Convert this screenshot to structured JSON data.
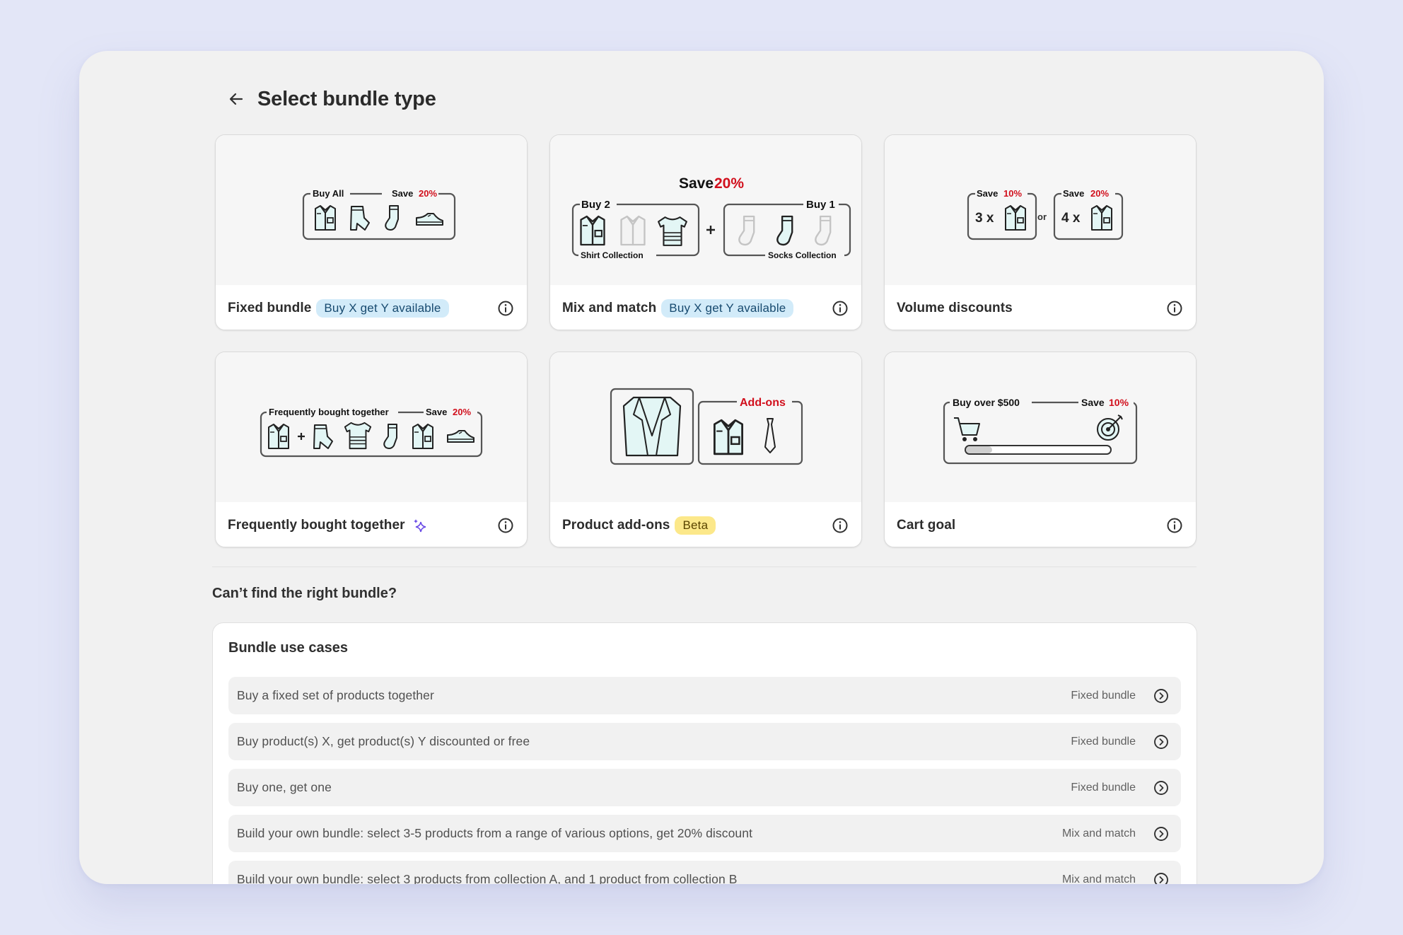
{
  "page": {
    "title": "Select bundle type"
  },
  "cards": [
    {
      "title": "Fixed bundle",
      "badge": "Buy X get Y available",
      "illus": {
        "left_label": "Buy All",
        "right_label": "Save",
        "percent": "20%"
      }
    },
    {
      "title": "Mix and match",
      "badge": "Buy X get Y available",
      "illus": {
        "heading": "Save",
        "percent": "20%",
        "left_top": "Buy 2",
        "left_bottom": "Shirt Collection",
        "right_top": "Buy 1",
        "right_bottom": "Socks Collection"
      }
    },
    {
      "title": "Volume discounts",
      "illus": {
        "save": "Save",
        "percent_a": "10%",
        "percent_b": "20%",
        "qty_a": "3 x",
        "qty_b": "4 x",
        "or": "or"
      }
    },
    {
      "title": "Frequently bought together",
      "illus": {
        "left_label": "Frequently bought together",
        "right_label": "Save",
        "percent": "20%"
      }
    },
    {
      "title": "Product add-ons",
      "badge": "Beta",
      "illus": {
        "addons_label": "Add-ons"
      }
    },
    {
      "title": "Cart goal",
      "illus": {
        "left_label": "Buy over $500",
        "right_label": "Save",
        "percent": "10%",
        "progress": 0.18
      }
    }
  ],
  "section": {
    "title": "Can’t find the right bundle?"
  },
  "use_cases": {
    "title": "Bundle use cases",
    "items": [
      {
        "text": "Buy a fixed set of products together",
        "type": "Fixed bundle"
      },
      {
        "text": "Buy product(s) X, get product(s) Y discounted or free",
        "type": "Fixed bundle"
      },
      {
        "text": "Buy one, get one",
        "type": "Fixed bundle"
      },
      {
        "text": "Build your own bundle: select 3-5 products from a range of various options, get 20% discount",
        "type": "Mix and match"
      },
      {
        "text": "Build your own bundle: select 3 products from collection A, and 1 product from collection B",
        "type": "Mix and match"
      }
    ]
  },
  "colors": {
    "accent_red": "#d10f1c",
    "badge_blue": "#d2ebf9",
    "badge_yellow": "#fce88a",
    "chat_fab": "#f4174f",
    "product_fill": "#e3f6f5"
  },
  "icons": {
    "back": "arrow-left-icon",
    "info": "info-icon",
    "sparkle": "sparkle-icon",
    "row_arrow": "chevron-right-circle-icon",
    "chat": "chat-icon"
  }
}
